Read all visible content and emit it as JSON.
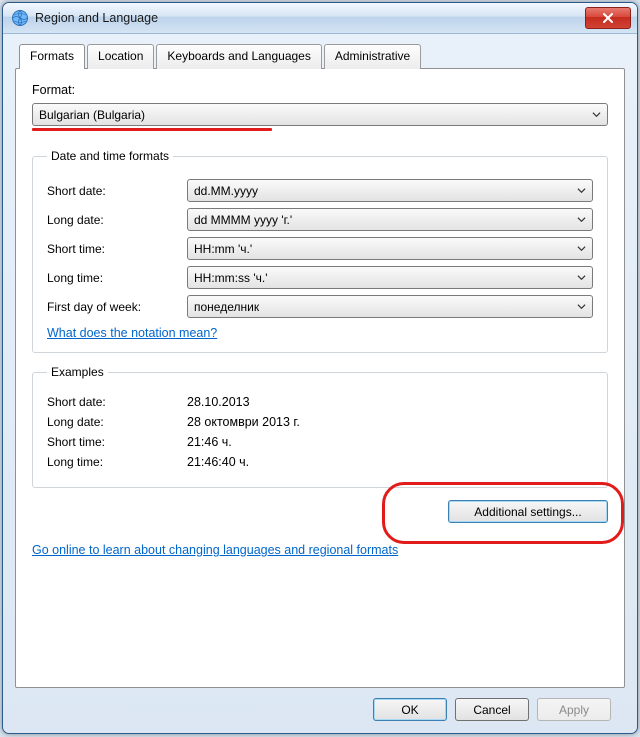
{
  "window": {
    "title": "Region and Language"
  },
  "tabs": {
    "formats": "Formats",
    "location": "Location",
    "keyboards": "Keyboards and Languages",
    "administrative": "Administrative"
  },
  "format": {
    "label": "Format:",
    "value": "Bulgarian (Bulgaria)"
  },
  "groups": {
    "datetime_legend": "Date and time formats",
    "examples_legend": "Examples"
  },
  "datetime": {
    "short_date_label": "Short date:",
    "short_date_value": "dd.MM.yyyy",
    "long_date_label": "Long date:",
    "long_date_value": "dd MMMM yyyy 'г.'",
    "short_time_label": "Short time:",
    "short_time_value": "HH:mm 'ч.'",
    "long_time_label": "Long time:",
    "long_time_value": "HH:mm:ss 'ч.'",
    "first_day_label": "First day of week:",
    "first_day_value": "понеделник",
    "notation_link": "What does the notation mean?"
  },
  "examples": {
    "short_date_label": "Short date:",
    "short_date_value": "28.10.2013",
    "long_date_label": "Long date:",
    "long_date_value": "28 октомври 2013 г.",
    "short_time_label": "Short time:",
    "short_time_value": "21:46 ч.",
    "long_time_label": "Long time:",
    "long_time_value": "21:46:40 ч."
  },
  "buttons": {
    "additional": "Additional settings...",
    "ok": "OK",
    "cancel": "Cancel",
    "apply": "Apply"
  },
  "links": {
    "online": "Go online to learn about changing languages and regional formats"
  }
}
